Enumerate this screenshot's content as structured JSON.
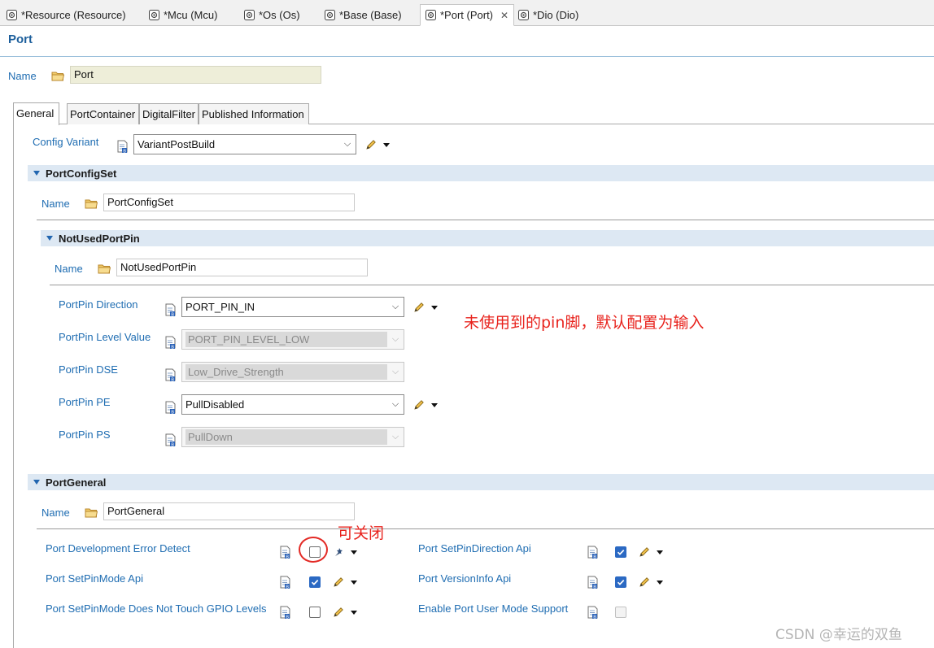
{
  "editor_tabs": [
    {
      "label": "*Resource (Resource)",
      "active": false
    },
    {
      "label": "*Mcu (Mcu)",
      "active": false
    },
    {
      "label": "*Os (Os)",
      "active": false
    },
    {
      "label": "*Base (Base)",
      "active": false
    },
    {
      "label": "*Port (Port)",
      "active": true
    },
    {
      "label": "*Dio (Dio)",
      "active": false
    }
  ],
  "page": {
    "title": "Port",
    "name_label": "Name",
    "name_value": "Port"
  },
  "form_tabs": [
    "General",
    "PortContainer",
    "DigitalFilter",
    "Published Information"
  ],
  "general": {
    "config_variant": {
      "label": "Config Variant",
      "value": "VariantPostBuild"
    },
    "port_config_set": {
      "header": "PortConfigSet",
      "name_label": "Name",
      "name_value": "PortConfigSet",
      "not_used_port_pin": {
        "header": "NotUsedPortPin",
        "name_label": "Name",
        "name_value": "NotUsedPortPin",
        "params": [
          {
            "label": "PortPin Direction",
            "value": "PORT_PIN_IN",
            "enabled": true
          },
          {
            "label": "PortPin Level Value",
            "value": "PORT_PIN_LEVEL_LOW",
            "enabled": false
          },
          {
            "label": "PortPin DSE",
            "value": "Low_Drive_Strength",
            "enabled": false
          },
          {
            "label": "PortPin PE",
            "value": "PullDisabled",
            "enabled": true
          },
          {
            "label": "PortPin PS",
            "value": "PullDown",
            "enabled": false
          }
        ]
      }
    },
    "port_general": {
      "header": "PortGeneral",
      "name_label": "Name",
      "name_value": "PortGeneral",
      "options": [
        {
          "label": "Port Development Error Detect",
          "checked": false,
          "enabled": true
        },
        {
          "label": "Port SetPinDirection Api",
          "checked": true,
          "enabled": true
        },
        {
          "label": "Port SetPinMode Api",
          "checked": true,
          "enabled": true
        },
        {
          "label": "Port VersionInfo Api",
          "checked": true,
          "enabled": true
        },
        {
          "label": "Port SetPinMode Does Not Touch GPIO Levels",
          "checked": false,
          "enabled": true
        },
        {
          "label": "Enable Port User Mode Support",
          "checked": false,
          "enabled": false
        }
      ]
    }
  },
  "annotations": {
    "unused_pin_note": "未使用到的pin脚，默认配置为输入",
    "can_close_note": "可关闭"
  },
  "watermark": "CSDN @幸运的双鱼",
  "colors": {
    "label_blue": "#1f6db2",
    "section_bar": "#dde8f3",
    "checkbox_blue": "#2b69c3",
    "annotation_red": "#e8231d"
  },
  "icons": [
    "editor-icon",
    "close-icon",
    "folder-icon",
    "param-icon",
    "pencil-icon",
    "dropdown-arrow-icon",
    "wand-icon",
    "combo-arrow-icon"
  ]
}
